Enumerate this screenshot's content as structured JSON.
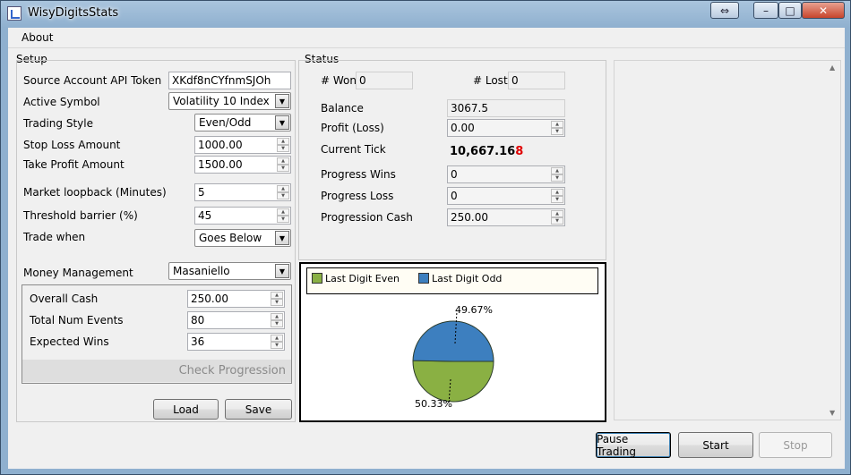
{
  "window": {
    "title": "WisyDigitsStats"
  },
  "menu": {
    "about": "About"
  },
  "setup": {
    "title": "Setup",
    "api_token_label": "Source Account API Token",
    "api_token_value": "XKdf8nCYfnmSJOh",
    "active_symbol_label": "Active Symbol",
    "active_symbol_value": "Volatility 10 Index",
    "trading_style_label": "Trading Style",
    "trading_style_value": "Even/Odd",
    "stop_loss_label": "Stop Loss Amount",
    "stop_loss_value": "1000.00",
    "take_profit_label": "Take Profit Amount",
    "take_profit_value": "1500.00",
    "loopback_label": "Market loopback (Minutes)",
    "loopback_value": "5",
    "threshold_label": "Threshold barrier (%)",
    "threshold_value": "45",
    "trade_when_label": "Trade when",
    "trade_when_value": "Goes Below",
    "money_mgmt_label": "Money Management",
    "money_mgmt_value": "Masaniello",
    "overall_cash_label": "Overall Cash",
    "overall_cash_value": "250.00",
    "total_events_label": "Total Num Events",
    "total_events_value": "80",
    "expected_wins_label": "Expected Wins",
    "expected_wins_value": "36",
    "check_progression": "Check Progression",
    "load_button": "Load",
    "save_button": "Save"
  },
  "status": {
    "title": "Status",
    "won_label": "# Won",
    "won_value": "0",
    "lost_label": "# Lost",
    "lost_value": "0",
    "balance_label": "Balance",
    "balance_value": "3067.5",
    "profit_label": "Profit (Loss)",
    "profit_value": "0.00",
    "current_tick_label": "Current Tick",
    "current_tick_main": "10,667.16",
    "current_tick_last": "8",
    "progress_wins_label": "Progress Wins",
    "progress_wins_value": "0",
    "progress_loss_label": "Progress Loss",
    "progress_loss_value": "0",
    "progression_cash_label": "Progression Cash",
    "progression_cash_value": "250.00"
  },
  "chart_data": {
    "type": "pie",
    "categories": [
      "Last Digit Even",
      "Last Digit Odd"
    ],
    "values": [
      50.33,
      49.67
    ],
    "labels": [
      "50.33%",
      "49.67%"
    ],
    "colors": [
      "#8ab043",
      "#3d7fbf"
    ],
    "legend": "top"
  },
  "buttons": {
    "pause": "Pause Trading",
    "start": "Start",
    "stop": "Stop"
  }
}
